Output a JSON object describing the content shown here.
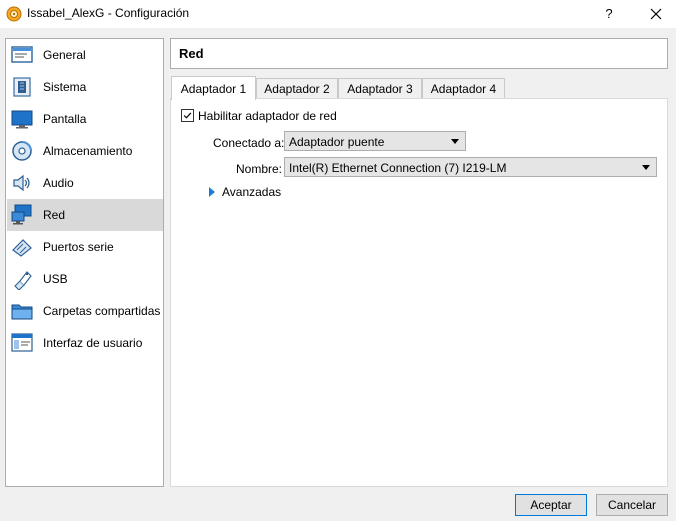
{
  "window": {
    "title": "Issabel_AlexG - Configuración",
    "help_label": "?"
  },
  "sidebar": {
    "items": [
      {
        "label": "General",
        "icon": "general-icon"
      },
      {
        "label": "Sistema",
        "icon": "chip-icon"
      },
      {
        "label": "Pantalla",
        "icon": "monitor-icon"
      },
      {
        "label": "Almacenamiento",
        "icon": "disk-icon"
      },
      {
        "label": "Audio",
        "icon": "speaker-icon"
      },
      {
        "label": "Red",
        "icon": "network-icon",
        "selected": true
      },
      {
        "label": "Puertos serie",
        "icon": "serial-port-icon"
      },
      {
        "label": "USB",
        "icon": "usb-icon"
      },
      {
        "label": "Carpetas compartidas",
        "icon": "folder-icon"
      },
      {
        "label": "Interfaz de usuario",
        "icon": "window-icon"
      }
    ]
  },
  "section": {
    "title": "Red"
  },
  "tabs": [
    {
      "label": "Adaptador 1",
      "active": true
    },
    {
      "label": "Adaptador 2"
    },
    {
      "label": "Adaptador 3"
    },
    {
      "label": "Adaptador 4"
    }
  ],
  "adapter": {
    "enable_label": "Habilitar adaptador de red",
    "enabled": true,
    "connected_label": "Conectado a:",
    "connected_value": "Adaptador puente",
    "name_label": "Nombre:",
    "name_value": "Intel(R) Ethernet Connection (7) I219-LM",
    "advanced_label": "Avanzadas"
  },
  "buttons": {
    "accept": "Aceptar",
    "cancel": "Cancelar"
  },
  "colors": {
    "accent": "#0078d7",
    "selection": "#d9d9d9",
    "expander": "#1e7ad8"
  }
}
